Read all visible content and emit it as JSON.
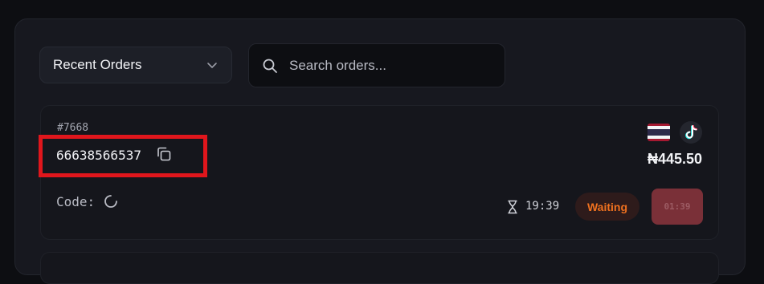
{
  "orders_filter": {
    "selected": "Recent Orders",
    "chevron_icon": "chevron-down-icon"
  },
  "search": {
    "placeholder": "Search orders...",
    "value": "",
    "icon": "search-icon"
  },
  "order": {
    "id": "#7668",
    "phone": "66638566537",
    "copy_icon": "copy-icon",
    "code_label": "Code:",
    "code_icon": "spinner-icon",
    "country_icon": "thailand-flag-icon",
    "service_icon": "tiktok-icon",
    "price": "₦445.50",
    "timer_icon": "hourglass-icon",
    "elapsed": "19:39",
    "status": "Waiting",
    "countdown": "01:39"
  },
  "colors": {
    "status_text": "#f0711f",
    "status_bg": "#2e1b1b",
    "countdown_bg": "#7a3038",
    "highlight": "#e0161c"
  }
}
